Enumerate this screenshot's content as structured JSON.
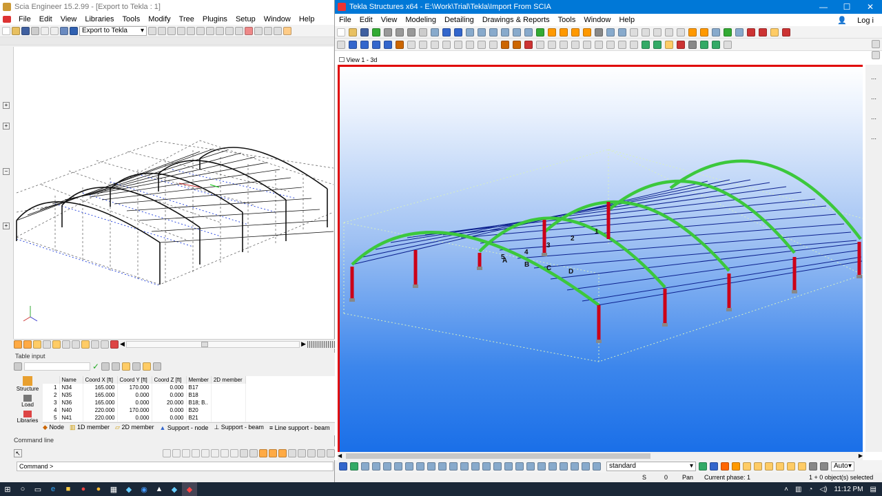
{
  "scia": {
    "title": "Scia Engineer 15.2.99 - [Export to Tekla : 1]",
    "menu": [
      "File",
      "Edit",
      "View",
      "Libraries",
      "Tools",
      "Modify",
      "Tree",
      "Plugins",
      "Setup",
      "Window",
      "Help"
    ],
    "project_combo": "Export to Tekla",
    "table_input_label": "Table input",
    "side_items": [
      "Structure",
      "Load",
      "Libraries"
    ],
    "table": {
      "columns": [
        "Name",
        "Coord X [ft]",
        "Coord Y [ft]",
        "Coord Z [ft]",
        "Member",
        "2D member"
      ],
      "rows": [
        {
          "idx": "1",
          "name": "N34",
          "x": "165.000",
          "y": "170.000",
          "z": "0.000",
          "member": "B17",
          "member2d": ""
        },
        {
          "idx": "2",
          "name": "N35",
          "x": "165.000",
          "y": "0.000",
          "z": "0.000",
          "member": "B18",
          "member2d": ""
        },
        {
          "idx": "3",
          "name": "N36",
          "x": "165.000",
          "y": "0.000",
          "z": "20.000",
          "member": "B18; B..",
          "member2d": ""
        },
        {
          "idx": "4",
          "name": "N40",
          "x": "220.000",
          "y": "170.000",
          "z": "0.000",
          "member": "B20",
          "member2d": ""
        },
        {
          "idx": "5",
          "name": "N41",
          "x": "220.000",
          "y": "0.000",
          "z": "0.000",
          "member": "B21",
          "member2d": ""
        }
      ]
    },
    "bottom_tabs": [
      "Node",
      "1D member",
      "2D member",
      "Support - node",
      "Support - beam",
      "Line support - beam"
    ],
    "command_line_label": "Command line",
    "command_prompt": "Command >"
  },
  "tekla": {
    "title": "Tekla Structures x64 - E:\\Work\\Trial\\Tekla\\Import From SCIA",
    "menu": [
      "File",
      "Edit",
      "View",
      "Modeling",
      "Detailing",
      "Drawings & Reports",
      "Tools",
      "Window",
      "Help"
    ],
    "login": "Log i",
    "view_title": "View 1 - 3d",
    "grid_labels": [
      "1",
      "2",
      "3",
      "4",
      "5",
      "A",
      "B",
      "C",
      "D"
    ],
    "selection_combo": "standard",
    "zoom_combo": "Auto",
    "status": {
      "snap": "S",
      "count": "0",
      "mode": "Pan",
      "phase": "Current phase: 1",
      "selected": "1 + 0 object(s) selected"
    }
  },
  "taskbar": {
    "time": "11:12 PM"
  },
  "colors": {
    "tekla_title": "#0078d7",
    "beam_green": "#3cc83c",
    "column_red": "#cc0018",
    "purlin_blue": "#0a1e8c"
  }
}
